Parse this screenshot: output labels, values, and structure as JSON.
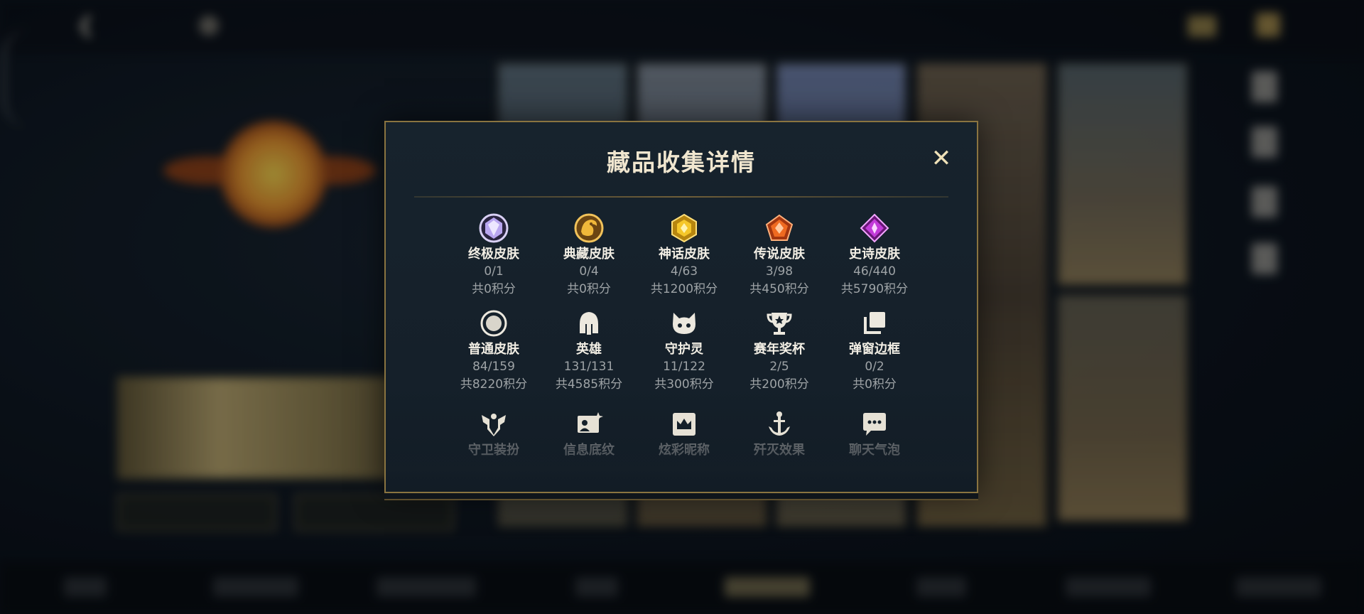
{
  "modal": {
    "title": "藏品收集详情",
    "close_glyph": "✕"
  },
  "categories": [
    {
      "label": "终极皮肤",
      "count": "0/1",
      "points": "共0积分",
      "icon": "ultimate-skin-icon",
      "color": "#b9a6f0"
    },
    {
      "label": "典藏皮肤",
      "count": "0/4",
      "points": "共0积分",
      "icon": "collection-skin-icon",
      "color": "#e0a730"
    },
    {
      "label": "神话皮肤",
      "count": "4/63",
      "points": "共1200积分",
      "icon": "mythic-skin-icon",
      "color": "#f0c020"
    },
    {
      "label": "传说皮肤",
      "count": "3/98",
      "points": "共450积分",
      "icon": "legend-skin-icon",
      "color": "#ef6a20"
    },
    {
      "label": "史诗皮肤",
      "count": "46/440",
      "points": "共5790积分",
      "icon": "epic-skin-icon",
      "color": "#c23ad8"
    },
    {
      "label": "普通皮肤",
      "count": "84/159",
      "points": "共8220积分",
      "icon": "normal-skin-icon",
      "color": "#e8e4da"
    },
    {
      "label": "英雄",
      "count": "131/131",
      "points": "共4585积分",
      "icon": "hero-helmet-icon",
      "color": "#e8e4da"
    },
    {
      "label": "守护灵",
      "count": "11/122",
      "points": "共300积分",
      "icon": "guardian-spirit-icon",
      "color": "#e8e4da"
    },
    {
      "label": "赛年奖杯",
      "count": "2/5",
      "points": "共200积分",
      "icon": "trophy-icon",
      "color": "#e8e4da"
    },
    {
      "label": "弹窗边框",
      "count": "0/2",
      "points": "共0积分",
      "icon": "popup-frame-icon",
      "color": "#e8e4da"
    }
  ],
  "faded_categories": [
    {
      "label": "守卫装扮",
      "icon": "guard-outfit-icon"
    },
    {
      "label": "信息底纹",
      "icon": "info-background-icon"
    },
    {
      "label": "炫彩昵称",
      "icon": "colorful-nickname-icon"
    },
    {
      "label": "歼灭效果",
      "icon": "annihilation-effect-icon"
    },
    {
      "label": "聊天气泡",
      "icon": "chat-bubble-icon"
    }
  ],
  "colors": {
    "modal_border": "#8a7440",
    "title": "#f0e6cf",
    "label": "#f2eee4",
    "muted": "#9ea3a6"
  }
}
